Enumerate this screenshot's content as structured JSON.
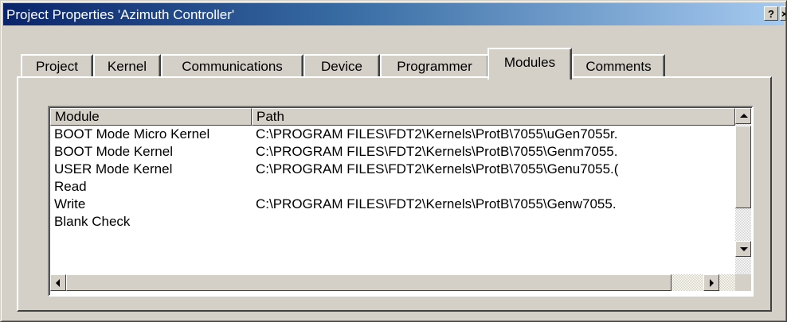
{
  "window": {
    "title": "Project Properties 'Azimuth Controller'",
    "help_label": "?",
    "close_label": "×"
  },
  "tabs": [
    {
      "label": "Project"
    },
    {
      "label": "Kernel"
    },
    {
      "label": "Communications"
    },
    {
      "label": "Device"
    },
    {
      "label": "Programmer"
    },
    {
      "label": "Modules",
      "active": true
    },
    {
      "label": "Comments"
    }
  ],
  "modules_table": {
    "columns": [
      "Module",
      "Path"
    ],
    "rows": [
      {
        "module": "BOOT Mode Micro Kernel",
        "path": "C:\\PROGRAM FILES\\FDT2\\Kernels\\ProtB\\7055\\uGen7055r."
      },
      {
        "module": "BOOT Mode Kernel",
        "path": "C:\\PROGRAM FILES\\FDT2\\Kernels\\ProtB\\7055\\Genm7055."
      },
      {
        "module": "USER Mode Kernel",
        "path": "C:\\PROGRAM FILES\\FDT2\\Kernels\\ProtB\\7055\\Genu7055.("
      },
      {
        "module": "Read",
        "path": ""
      },
      {
        "module": "Write",
        "path": "C:\\PROGRAM FILES\\FDT2\\Kernels\\ProtB\\7055\\Genw7055."
      },
      {
        "module": "Blank Check",
        "path": ""
      }
    ]
  },
  "colors": {
    "face": "#d4d0c8",
    "title_start": "#0a246a",
    "title_end": "#a6caf0"
  }
}
